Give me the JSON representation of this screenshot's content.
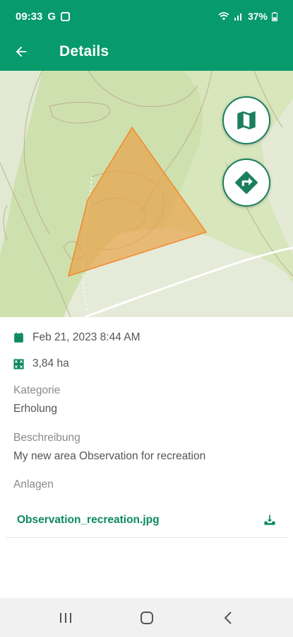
{
  "status_bar": {
    "time": "09:33",
    "g_label": "G",
    "battery": "37%"
  },
  "header": {
    "title": "Details",
    "color": "#079a6b"
  },
  "map": {
    "polygon_fill": "#e8a24a",
    "polygon_stroke": "#f08a2a",
    "buttons": [
      "map-layers-icon",
      "directions-icon"
    ]
  },
  "details": {
    "date": "Feb 21, 2023 8:44 AM",
    "area": "3,84 ha",
    "category_label": "Kategorie",
    "category_value": "Erholung",
    "description_label": "Beschreibung",
    "description_value": "My new area Observation for recreation",
    "attachments_label": "Anlagen",
    "attachment_name": "Observation_recreation.jpg"
  },
  "nav_bar": {
    "buttons": [
      "recent-apps-icon",
      "home-icon",
      "back-nav-icon"
    ]
  }
}
